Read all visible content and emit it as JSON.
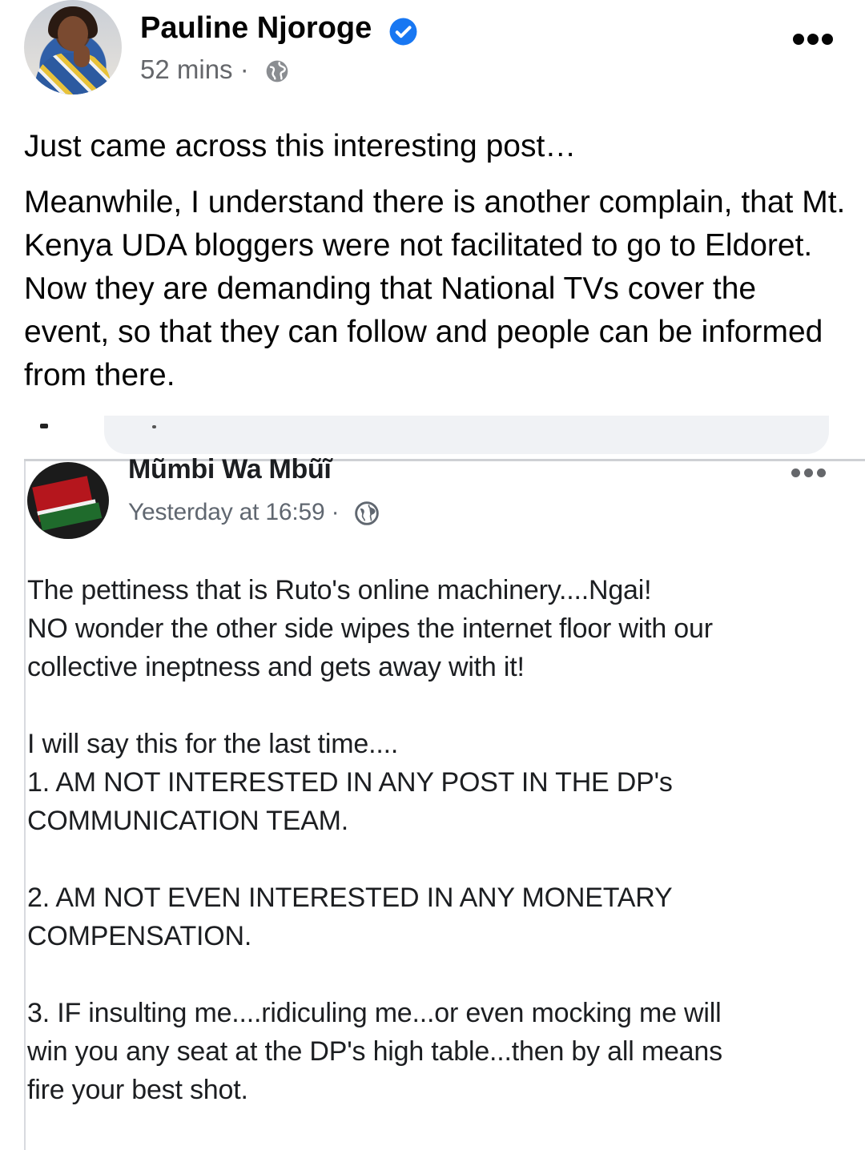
{
  "post": {
    "author": "Pauline Njoroge",
    "time": "52 mins ·",
    "paragraphs": [
      "Just came across this interesting post…",
      "Meanwhile, I understand there is another complain, that Mt. Kenya UDA bloggers were not facilitated to go to Eldoret. Now they are demanding that National TVs cover the event, so that they can follow and people can be informed from there."
    ],
    "icons": {
      "verified": "verified-badge-icon",
      "audience": "globe-icon",
      "menu": "more-options-icon"
    }
  },
  "embedded": {
    "author": "Mũmbi Wa Mbũĩ",
    "time": "Yesterday at 16:59 ·",
    "paragraph1": [
      "The pettiness that is Ruto's online machinery....Ngai!",
      "NO wonder the other side wipes the internet floor with our",
      "collective ineptness and gets away with it!"
    ],
    "paragraph2": [
      "I will say this for the last time....",
      "1. AM NOT INTERESTED IN ANY POST IN THE DP's",
      "COMMUNICATION TEAM."
    ],
    "paragraph3": [
      "2. AM NOT EVEN INTERESTED IN ANY MONETARY",
      "COMPENSATION."
    ],
    "paragraph4": [
      "3. IF insulting me....ridiculing me...or even mocking me will",
      "win you any seat at the DP's high table...then by all means",
      "fire your best shot."
    ]
  },
  "colors": {
    "verified": "#1877f2",
    "secondary_text": "#65676b",
    "primary_text": "#050505"
  }
}
